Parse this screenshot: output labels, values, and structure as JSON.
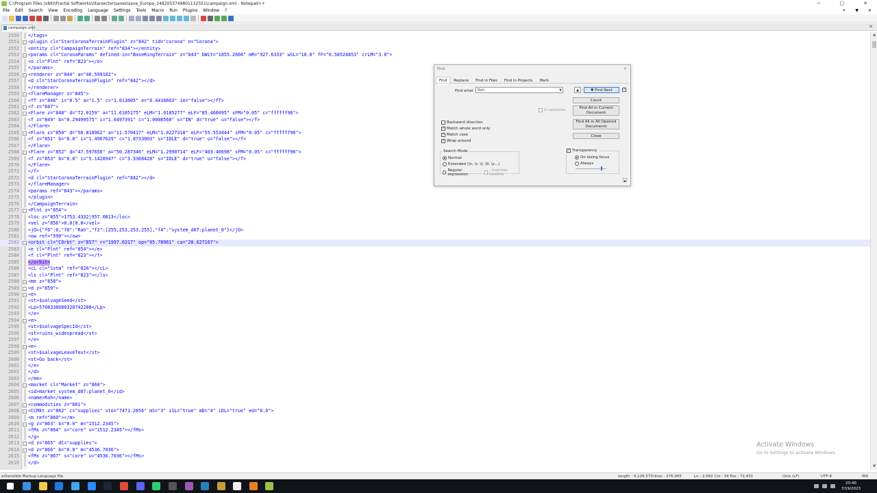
{
  "window": {
    "title": "C:\\Program Files (x86)\\Fractal Softworks\\Starsector\\saves\\save_Europa_1482053749801132551\\campaign.xml - Notepad++",
    "controls": [
      "─",
      "□",
      "✕"
    ]
  },
  "menu": {
    "items": [
      "File",
      "Edit",
      "Search",
      "View",
      "Encoding",
      "Language",
      "Settings",
      "Tools",
      "Macro",
      "Run",
      "Plugins",
      "Window",
      "?"
    ],
    "right": [
      "+",
      "▼",
      "✕"
    ]
  },
  "tab": {
    "label": "campaign.xml",
    "close": "✕"
  },
  "editor": {
    "lines": [
      {
        "n": "2550",
        "code": "</tags>",
        "fold": "vline"
      },
      {
        "n": "2551",
        "code": "<plugin cl=\"StarCoronaTerrainPlugin\" z=\"842\" tid=\"corona\" n=\"Corona\">",
        "fold": "box"
      },
      {
        "n": "2552",
        "code": "<entity cl=\"CampaignTerrain\" ref=\"834\"></entity>",
        "fold": "vline"
      },
      {
        "n": "2553",
        "code": "<params cl=\"CoronaParams\" defined-in=\"BaseRingTerrain\" z=\"843\" bWit=\"1855.2666\" mR=\"927.6333\" wSL=\"10.0\" fF=\"0.58524853\" crLM=\"3.0\">",
        "fold": "box"
      },
      {
        "n": "2554",
        "code": "<o cl=\"Plnt\" ref=\"823\"></o>",
        "fold": "vline"
      },
      {
        "n": "2555",
        "code": "</params>",
        "fold": "vline"
      },
      {
        "n": "2556",
        "code": "<renderer z=\"844\" a=\"40.599182\">",
        "fold": "box"
      },
      {
        "n": "2557",
        "code": "<d cl=\"StarCoronaTerrainPlugin\" ref=\"842\"></d>",
        "fold": "vline"
      },
      {
        "n": "2558",
        "code": "</renderer>",
        "fold": "vline"
      },
      {
        "n": "2559",
        "code": "<flareManager z=\"845\">",
        "fold": "box"
      },
      {
        "n": "2560",
        "code": "<fT z=\"846\" i=\"0.5\" a=\"1.5\" c=\"1.013005\" e=\"0.4416663\" ie=\"false\"></fT>",
        "fold": "vline"
      },
      {
        "n": "2561",
        "code": "<f z=\"847\">",
        "fold": "box"
      },
      {
        "n": "2562",
        "code": "<Flare z=\"848\" d=\"72.0159\" a=\"11.6105175\" eLM=\"1.0185277\" eLF=\"85.466095\" sFM=\"0.05\" c=\"ffffff96\">",
        "fold": "box"
      },
      {
        "n": "2563",
        "code": "<f z=\"849\" b=\"0.29499575\" i=\"1.6497391\" c=\"1.0008568\" s=\"IN\" d=\"true\" u=\"false\"></f>",
        "fold": "vline"
      },
      {
        "n": "2564",
        "code": "</Flare>",
        "fold": "vline"
      },
      {
        "n": "2565",
        "code": "<Flare z=\"850\" d=\"58.818962\" a=\"11.570417\" eLM=\"1.0227318\" eLF=\"55.553444\" sFM=\"0.05\" c=\"ffffff96\">",
        "fold": "box"
      },
      {
        "n": "2566",
        "code": "<f z=\"851\" b=\"0.0\" i=\"1.4967629\" c=\"1.8733003\" s=\"IDLE\" d=\"true\" u=\"false\"></f>",
        "fold": "vline"
      },
      {
        "n": "2567",
        "code": "</Flare>",
        "fold": "vline"
      },
      {
        "n": "2568",
        "code": "<Flare z=\"852\" d=\"47.597656\" a=\"50.287346\" eLM=\"1.2990714\" eLF=\"403.40698\" sFM=\"0.05\" c=\"ffffff96\">",
        "fold": "box"
      },
      {
        "n": "2569",
        "code": "<f z=\"853\" b=\"0.0\" i=\"5.1428947\" c=\"3.3368428\" s=\"IDLE\" d=\"true\" u=\"false\"></f>",
        "fold": "vline"
      },
      {
        "n": "2570",
        "code": "</Flare>",
        "fold": "vline"
      },
      {
        "n": "2571",
        "code": "</f>",
        "fold": "vline"
      },
      {
        "n": "2572",
        "code": "<d cl=\"StarCoronaTerrainPlugin\" ref=\"842\"></d>",
        "fold": "vline"
      },
      {
        "n": "2573",
        "code": "</flareManager>",
        "fold": "vline"
      },
      {
        "n": "2574",
        "code": "<params ref=\"843\"></params>",
        "fold": "vline"
      },
      {
        "n": "2575",
        "code": "</plugin>",
        "fold": "vline"
      },
      {
        "n": "2576",
        "code": "</CampaignTerrain>",
        "fold": "vline"
      },
      {
        "n": "2577",
        "code": "<Plnt z=\"854\">",
        "fold": "box"
      },
      {
        "n": "2578",
        "code": "<loc z=\"855\">1753.4332|957.0813</loc>",
        "fold": "vline"
      },
      {
        "n": "2579",
        "code": "<vel z=\"856\">0.0|0.0</vel>",
        "fold": "vline"
      },
      {
        "n": "2580",
        "code": "<jO>{\"f6\":0,\"f0\":\"Rah\",\"f2\":[255,253,253,255],\"f4\":\"system_d07:planet_0\"}</jO>",
        "fold": "vline"
      },
      {
        "n": "2581",
        "code": "<ow ref=\"590\"></ow>",
        "fold": "vline"
      },
      {
        "n": "2582",
        "code": "<orbit cl=\"COrbt\" z=\"857\" r=\"1997.6317\" op=\"95.78961\" ca=\"28.627167\">",
        "fold": "box",
        "current": true
      },
      {
        "n": "2583",
        "code": "<e cl=\"Plnt\" ref=\"854\"></e>",
        "fold": "vline"
      },
      {
        "n": "2584",
        "code": "<f cl=\"Plnt\" ref=\"823\"></f>",
        "fold": "vline"
      },
      {
        "n": "2585",
        "code": "</orbit>",
        "fold": "vline",
        "highlight": true
      },
      {
        "n": "2586",
        "code": "<cL cl=\"Sstm\" ref=\"826\"></cL>",
        "fold": "vline"
      },
      {
        "n": "2587",
        "code": "<ls cl=\"Plnt\" ref=\"823\"></ls>",
        "fold": "vline"
      },
      {
        "n": "2588",
        "code": "<me z=\"858\">",
        "fold": "box"
      },
      {
        "n": "2589",
        "code": "<d z=\"859\">",
        "fold": "box"
      },
      {
        "n": "2590",
        "code": "<e>",
        "fold": "box"
      },
      {
        "n": "2591",
        "code": "<st>$salvageSeed</st>",
        "fold": "vline"
      },
      {
        "n": "2592",
        "code": "<Lp>5708338080320742208</Lp>",
        "fold": "vline"
      },
      {
        "n": "2593",
        "code": "</e>",
        "fold": "vline"
      },
      {
        "n": "2594",
        "code": "<e>",
        "fold": "box"
      },
      {
        "n": "2595",
        "code": "<st>$salvageSpecId</st>",
        "fold": "vline"
      },
      {
        "n": "2596",
        "code": "<st>ruins_widespread</st>",
        "fold": "vline"
      },
      {
        "n": "2597",
        "code": "</e>",
        "fold": "vline"
      },
      {
        "n": "2598",
        "code": "<e>",
        "fold": "box"
      },
      {
        "n": "2599",
        "code": "<st>$salvageLeaveText</st>",
        "fold": "vline"
      },
      {
        "n": "2600",
        "code": "<st>Go back</st>",
        "fold": "vline"
      },
      {
        "n": "2601",
        "code": "</e>",
        "fold": "vline"
      },
      {
        "n": "2602",
        "code": "</d>",
        "fold": "vline"
      },
      {
        "n": "2603",
        "code": "</me>",
        "fold": "vline"
      },
      {
        "n": "2604",
        "code": "<market cl=\"Market\" z=\"860\">",
        "fold": "box"
      },
      {
        "n": "2605",
        "code": "<id>market_system_d07:planet_0</id>",
        "fold": "vline"
      },
      {
        "n": "2606",
        "code": "<name>Rah</name>",
        "fold": "vline"
      },
      {
        "n": "2607",
        "code": "<commodities z=\"861\">",
        "fold": "box"
      },
      {
        "n": "2608",
        "code": "<CCMkt z=\"862\" c=\"supplies\" sto=\"7471.2856\" mS=\"3\" iSL=\"true\" mD=\"4\" iDL=\"true\" eU=\"0.0\">",
        "fold": "box"
      },
      {
        "n": "2609",
        "code": "<m ref=\"860\"></m>",
        "fold": "vline"
      },
      {
        "n": "2610",
        "code": "<g z=\"863\" b=\"0.0\" m=\"1512.2345\">",
        "fold": "box"
      },
      {
        "n": "2611",
        "code": "<fMs z=\"864\" s=\"core\" v=\"1512.2345\"></fMs>",
        "fold": "vline"
      },
      {
        "n": "2612",
        "code": "</g>",
        "fold": "vline"
      },
      {
        "n": "2613",
        "code": "<d z=\"865\" dC=\"supplies\">",
        "fold": "box"
      },
      {
        "n": "2614",
        "code": "<d z=\"866\" b=\"0.0\" m=\"4536.7036\">",
        "fold": "box"
      },
      {
        "n": "2615",
        "code": "<fMs z=\"867\" s=\"core\" v=\"4536.7036\"></fMs>",
        "fold": "vline"
      },
      {
        "n": "2616",
        "code": "</d>",
        "fold": "vline"
      }
    ]
  },
  "find_dialog": {
    "title": "Find",
    "close": "✕",
    "tabs": [
      "Find",
      "Replace",
      "Find in Files",
      "Find in Projects",
      "Mark"
    ],
    "find_what_label": "Find what :",
    "find_what_value": "Rah",
    "swap": "▲",
    "buttons": {
      "find_next": "▼ Find Next",
      "count": "Count",
      "find_all_current": "Find All in Current Document",
      "find_all_opened": "Find All in All Opened Documents",
      "close": "Close"
    },
    "in_selection": "In selection",
    "options": [
      {
        "label": "Backward direction",
        "checked": false
      },
      {
        "label": "Match whole word only",
        "checked": true
      },
      {
        "label": "Match case",
        "checked": true
      },
      {
        "label": "Wrap around",
        "checked": true
      }
    ],
    "search_mode": {
      "label": "Search Mode",
      "normal": "Normal",
      "extended": "Extended (\\n, \\r, \\t, \\0, \\x...)",
      "regex": "Regular expression",
      "matches_newline": ". matches newline",
      "selected": "normal"
    },
    "transparency": {
      "label": "Transparency",
      "checked": true,
      "on_losing_focus": "On losing focus",
      "always": "Always",
      "selected": "on_losing_focus",
      "level": 0.85
    }
  },
  "statusbar": {
    "file_type": "eXtensible Markup Language file",
    "length": "length : 9,126,570",
    "lines": "lines : 276,065",
    "position": "Ln : 2,582    Col : 34    Pos : 72,431",
    "eol": "Unix (LF)",
    "encoding": "UTF-8",
    "mode": "INS"
  },
  "watermark": {
    "title": "Activate Windows",
    "subtitle": "Go to Settings to activate Windows."
  },
  "taskbar": {
    "time": "20:40",
    "date": "7/19/2023",
    "icon_colors": [
      "#ffffff",
      "#3a8ee6",
      "#f2c94c",
      "#1f7ae0",
      "#3ba8f0",
      "#2d8cff",
      "#1b2838",
      "#e04b3a",
      "#5865f2",
      "#2ecc71",
      "#555555",
      "#9b59b6",
      "#2980b9",
      "#c79a3a",
      "#eeeeee",
      "#e67e22",
      "#9ac247"
    ]
  }
}
